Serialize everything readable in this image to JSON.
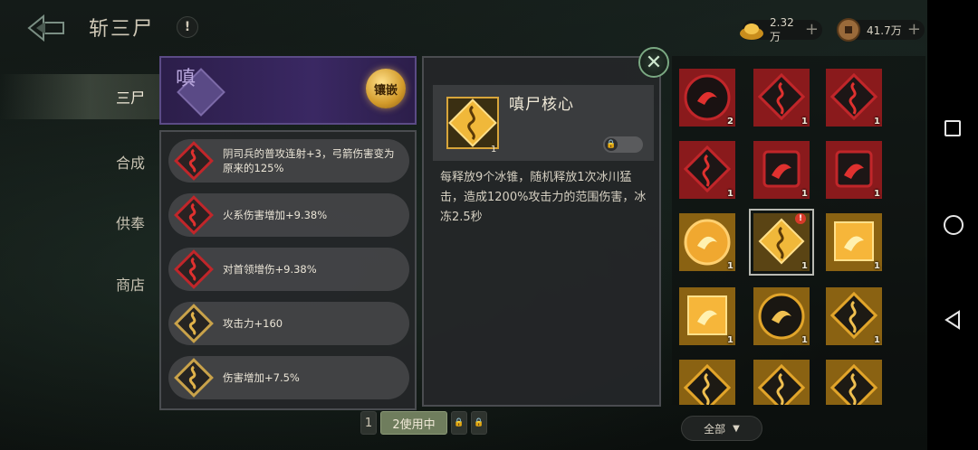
{
  "header": {
    "title": "斩三尸",
    "help_label": "!",
    "gold": "2.32万",
    "coins": "41.7万",
    "plus": "+"
  },
  "nav": {
    "items": [
      {
        "label": "三尸",
        "active": true
      },
      {
        "label": "合成",
        "active": false
      },
      {
        "label": "供奉",
        "active": false
      },
      {
        "label": "商店",
        "active": false
      }
    ]
  },
  "gem_banner": {
    "slot_char": "嗔",
    "inlay_label": "镶嵌"
  },
  "attributes": [
    {
      "text": "阴司兵的普攻连射+3，弓箭伤害变为原来的125%",
      "kind": "red"
    },
    {
      "text": "火系伤害增加+9.38%",
      "kind": "red"
    },
    {
      "text": "对首领增伤+9.38%",
      "kind": "red"
    },
    {
      "text": "攻击力+160",
      "kind": "gold"
    },
    {
      "text": "伤害增加+7.5%",
      "kind": "gold"
    }
  ],
  "detail": {
    "name": "嗔尸核心",
    "count": "1",
    "description": "每释放9个冰锥，随机释放1次冰川猛击，造成1200%攻击力的范围伤害，冰冻2.5秒",
    "close": "✕"
  },
  "pager": {
    "page1": "1",
    "page2": "2使用中"
  },
  "inventory": [
    {
      "kind": "red-round",
      "count": "2"
    },
    {
      "kind": "red-hex",
      "count": "1"
    },
    {
      "kind": "red-hex",
      "count": "1"
    },
    {
      "kind": "red-hex",
      "count": "1"
    },
    {
      "kind": "red-square",
      "count": "1"
    },
    {
      "kind": "red-square",
      "count": "1"
    },
    {
      "kind": "gold-round",
      "count": "1"
    },
    {
      "kind": "gold-diamond",
      "count": "1",
      "selected": true,
      "warn": "!"
    },
    {
      "kind": "gold-square",
      "count": "1"
    },
    {
      "kind": "gold-square",
      "count": "1"
    },
    {
      "kind": "gold-round-dark",
      "count": "1"
    },
    {
      "kind": "gold-hex",
      "count": "1"
    },
    {
      "kind": "gold-hex",
      "count": ""
    },
    {
      "kind": "gold-hex",
      "count": ""
    },
    {
      "kind": "gold-hex",
      "count": ""
    }
  ],
  "filter": {
    "label": "全部"
  },
  "colors": {
    "red": "#c1262a",
    "gold": "#e2a52a",
    "panel": "#242628",
    "purple": "#3a2863"
  }
}
